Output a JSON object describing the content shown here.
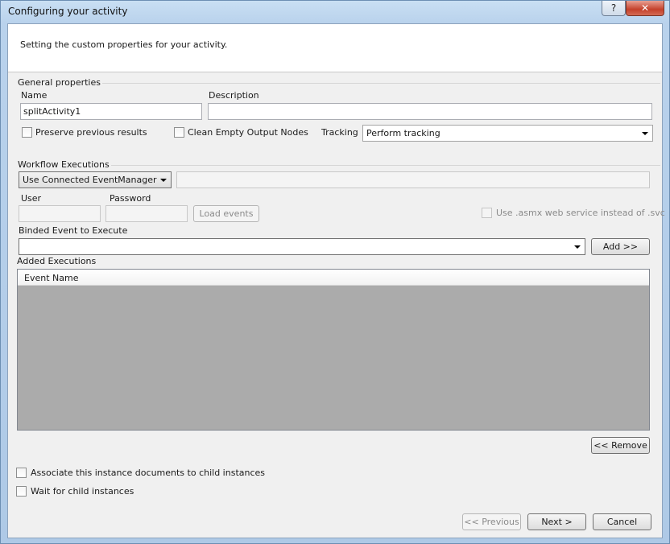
{
  "window": {
    "title": "Configuring your activity",
    "help_glyph": "?",
    "close_glyph": "✕"
  },
  "header": {
    "text": "Setting the custom properties for your activity."
  },
  "general": {
    "title": "General properties",
    "name_label": "Name",
    "name_value": "splitActivity1",
    "description_label": "Description",
    "description_value": "",
    "preserve_label": "Preserve previous results",
    "clean_label": "Clean Empty Output Nodes",
    "tracking_label": "Tracking",
    "tracking_value": "Perform tracking"
  },
  "workflow": {
    "title": "Workflow Executions",
    "source_value": "Use Connected EventManager",
    "user_label": "User",
    "password_label": "Password",
    "load_events_label": "Load events",
    "asmx_label": "Use .asmx web service instead of .svc",
    "binded_label": "Binded Event to Execute",
    "binded_value": "",
    "add_label": "Add >>",
    "added_label": "Added Executions",
    "column_event_name": "Event Name",
    "remove_label": "<< Remove"
  },
  "options": {
    "associate_label": "Associate this instance documents to child instances",
    "wait_label": "Wait for child instances"
  },
  "footer": {
    "previous_label": "<< Previous",
    "next_label": "Next >",
    "cancel_label": "Cancel"
  }
}
